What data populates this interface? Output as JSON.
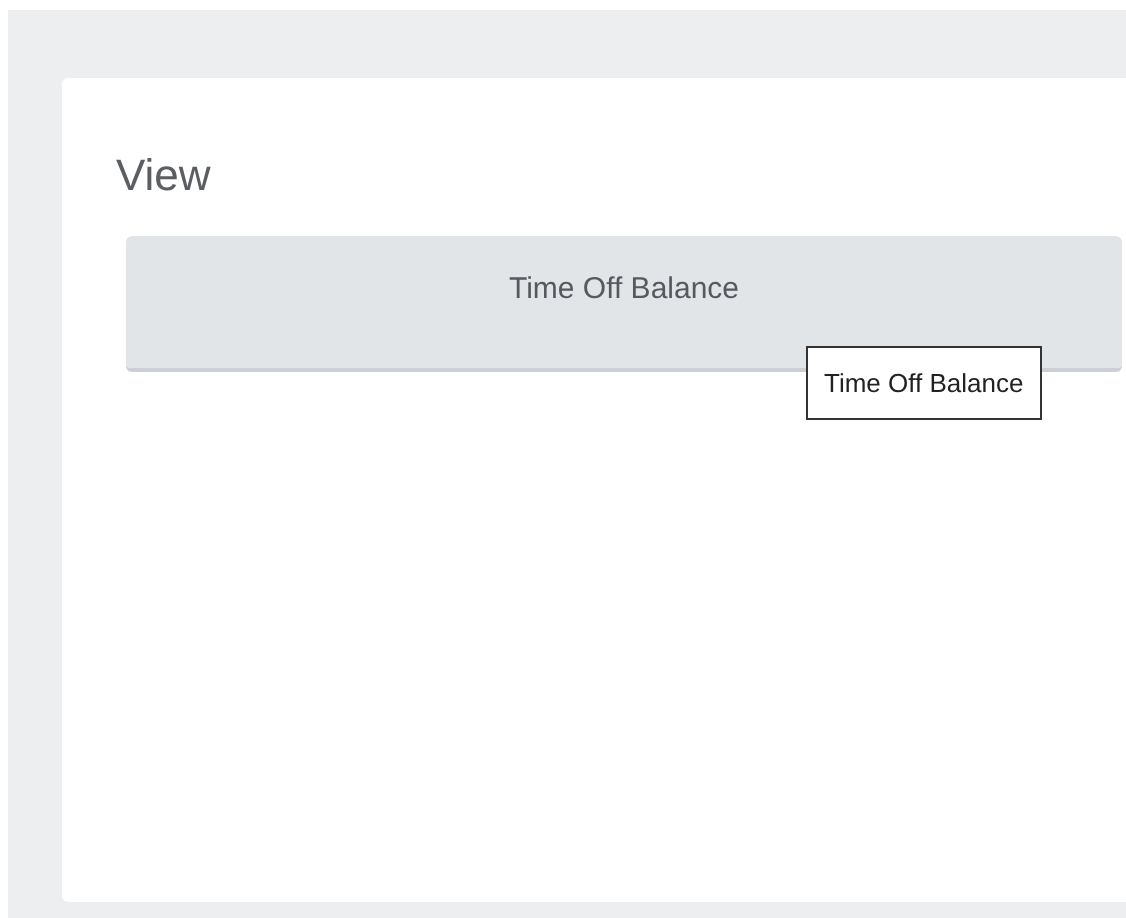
{
  "panel": {
    "title": "View"
  },
  "buttons": [
    {
      "label": "Time Off Balance"
    }
  ],
  "tooltip": {
    "text": "Time Off Balance"
  }
}
